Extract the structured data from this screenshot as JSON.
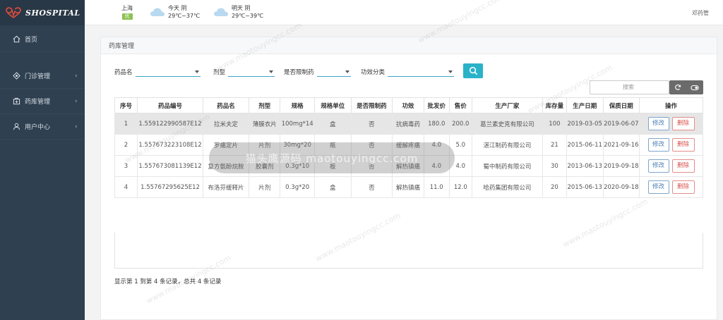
{
  "brand": {
    "name": "SHOSPITAL"
  },
  "sidebar": {
    "items": [
      {
        "label": "首页",
        "icon": "home-icon"
      },
      {
        "label": "门诊管理",
        "icon": "clinic-icon"
      },
      {
        "label": "药库管理",
        "icon": "pharmacy-icon"
      },
      {
        "label": "用户中心",
        "icon": "user-icon"
      }
    ]
  },
  "header": {
    "city": "上海",
    "city_badge": "优",
    "today": {
      "label": "今天 阴",
      "temp": "29℃~37℃"
    },
    "tomorrow": {
      "label": "明天 阴",
      "temp": "29℃~39℃"
    },
    "user": "邓药管"
  },
  "card": {
    "title": "药库管理"
  },
  "filters": {
    "drug_name": "药品名",
    "dosage": "剂型",
    "restricted": "是否限制药",
    "efficacy": "功效分类"
  },
  "table_search": {
    "placeholder": "搜索"
  },
  "table": {
    "columns": [
      "序号",
      "药品编号",
      "药品名",
      "剂型",
      "规格",
      "规格单位",
      "是否限制药",
      "功效",
      "批发价",
      "售价",
      "生产厂家",
      "库存量",
      "生产日期",
      "保质日期",
      "操作"
    ],
    "rows": [
      [
        "1",
        "1.559122990587E12",
        "拉米夫定",
        "薄膜衣片",
        "100mg*14",
        "盒",
        "否",
        "抗病毒药",
        "180.0",
        "200.0",
        "葛兰素史克有限公司",
        "100",
        "2019-03-05",
        "2019-06-07"
      ],
      [
        "2",
        "1.557673223108E12",
        "罗痛定片",
        "片剂",
        "30mg*20",
        "瓶",
        "否",
        "缓解疼痛",
        "4.0",
        "5.0",
        "湛江制药有限公司",
        "21",
        "2015-06-11",
        "2021-09-16"
      ],
      [
        "3",
        "1.557673081139E12",
        "复方氨酚烷胺",
        "胶囊剂",
        "0.3g*10",
        "板",
        "否",
        "解热镇痛",
        "4.0",
        "4.0",
        "蜀中制药有限公司",
        "30",
        "2013-06-13",
        "2019-09-18"
      ],
      [
        "4",
        "1.55767295625E12",
        "布洛芬缓释片",
        "片剂",
        "0.3g*20",
        "盒",
        "否",
        "解热镇痛",
        "11.0",
        "12.0",
        "哈药集团有限公司",
        "20",
        "2015-06-13",
        "2020-09-18"
      ]
    ],
    "edit_label": "修改",
    "delete_label": "删除"
  },
  "pager": {
    "summary": "显示第 1 到第 4 条记录，总共 4 条记录"
  },
  "watermark": {
    "text": "www.maotouyingcc.com",
    "overlay": "猫头鹰源码 maotouyingcc.com"
  },
  "colors": {
    "sidebar": "#2f4050",
    "accent": "#2ab2c9",
    "edit": "#4a7fb5",
    "delete": "#d9534f"
  }
}
